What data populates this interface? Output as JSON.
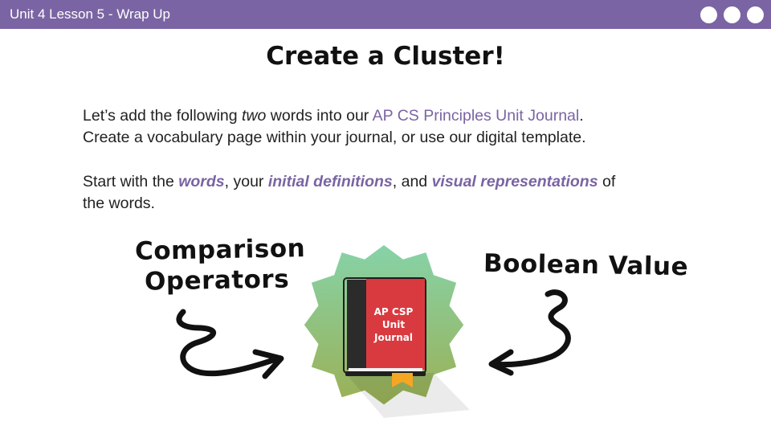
{
  "header": {
    "title": "Unit 4 Lesson 5 - Wrap Up",
    "nav_dots": 3,
    "bar_color": "#7a64a3"
  },
  "slide": {
    "title": "Create a Cluster!",
    "paragraph1": {
      "line1_pre": "Let’s add the following ",
      "line1_em": "two",
      "line1_mid": " words into our ",
      "line1_link": "AP CS Principles Unit Journal",
      "line1_post": ".",
      "line2": "Create a vocabulary page within your journal, or use our digital template."
    },
    "paragraph2": {
      "pre": "Start with the ",
      "kw1": "words",
      "sep1": ", your ",
      "kw2": "initial definitions",
      "sep2": ", and ",
      "kw3": "visual representations",
      "post_line1": " of",
      "line2": "the words."
    },
    "accent_color": "#7a64a3"
  },
  "cluster": {
    "left_word_line1": "Comparison",
    "left_word_line2": "Operators",
    "right_word": "Boolean Value",
    "book_line1": "AP CSP",
    "book_line2": "Unit",
    "book_line3": "Journal"
  },
  "icons": [
    "book-icon",
    "starburst-badge",
    "curly-arrow-left",
    "curly-arrow-right"
  ]
}
